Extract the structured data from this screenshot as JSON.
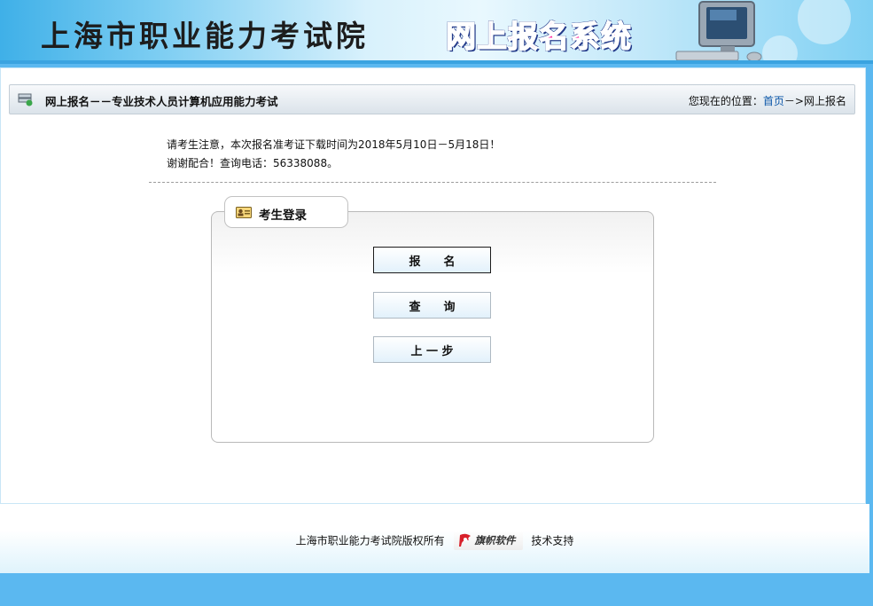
{
  "banner": {
    "title": "上海市职业能力考试院",
    "system_title": "网上报名系统"
  },
  "breadcrumb": {
    "title": "网上报名－－专业技术人员计算机应用能力考试",
    "location_prefix": "您现在的位置：",
    "home": "首页",
    "separator": "－>",
    "current": "网上报名"
  },
  "notice": {
    "line1": "请考生注意，本次报名准考证下载时间为2018年5月10日－5月18日！",
    "line2": "谢谢配合！查询电话：56338088。"
  },
  "login": {
    "tab_label": "考生登录",
    "buttons": {
      "register": "报　　名",
      "query": "查　　询",
      "back": "上 一 步"
    }
  },
  "footer": {
    "copyright": "上海市职业能力考试院版权所有",
    "logo_text": "旗帜软件",
    "support": "技术支持"
  },
  "colors": {
    "accent_blue": "#3aa3e0",
    "link": "#0b56a8",
    "system_title": "#ff2ba0"
  }
}
